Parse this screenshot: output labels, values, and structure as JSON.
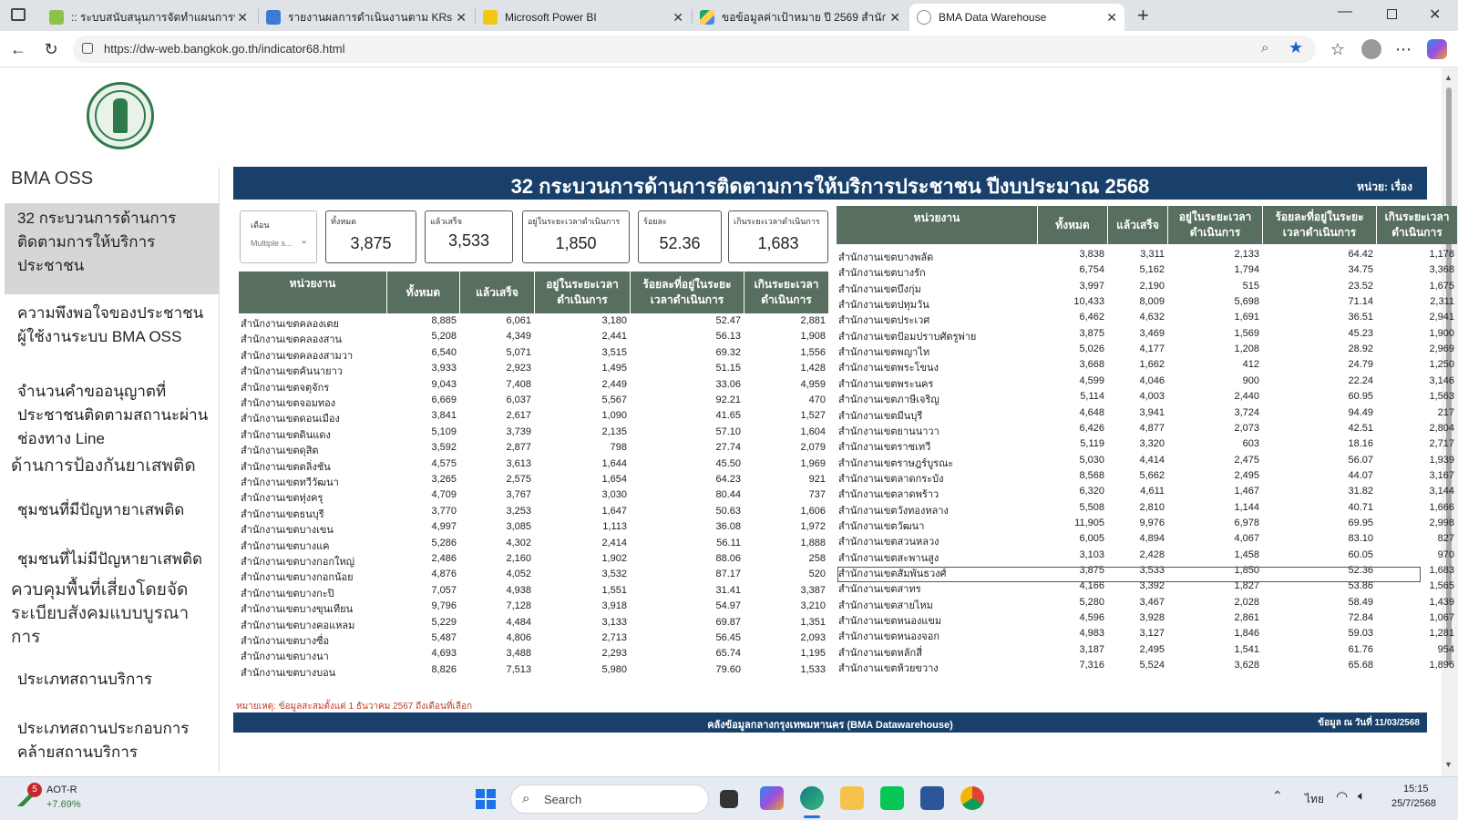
{
  "browser": {
    "tabs": [
      {
        "title": ":: ระบบสนับสนุนการจัดทำแผนการพัฒ",
        "icon": "sheet-icon"
      },
      {
        "title": "รายงานผลการดำเนินงานตาม KRs",
        "icon": "shield-icon"
      },
      {
        "title": "Microsoft Power BI",
        "icon": "powerbi-icon"
      },
      {
        "title": "ขอข้อมูลค่าเป้าหมาย ปี 2569 สำนักงา",
        "icon": "drive-icon"
      },
      {
        "title": "BMA Data Warehouse",
        "icon": "globe-icon"
      }
    ],
    "url": "https://dw-web.bangkok.go.th/indicator68.html"
  },
  "sidebar": {
    "header": "BMA OSS",
    "items": [
      {
        "label": "32 กระบวนการด้านการติดตามการให้บริการประชาชน",
        "lines": [
          "32 กระบวนการด้านการ",
          "ติดตามการให้บริการ",
          "ประชาชน"
        ]
      },
      {
        "label": "ความพึงพอใจของประชาชนผู้ใช้งานระบบ BMA OSS",
        "lines": [
          "ความพึงพอใจของประชาชน",
          "ผู้ใช้งานระบบ BMA OSS"
        ]
      },
      {
        "label": "จำนวนคำขออนุญาตที่ประชาชนติดตามสถานะผ่านช่องทาง Line",
        "lines": [
          "จำนวนคำขออนุญาตที่",
          "ประชาชนติดตามสถานะผ่าน",
          "ช่องทาง Line"
        ]
      },
      {
        "label": "ด้านการป้องกันยาเสพติด",
        "lines": [
          "ด้านการป้องกันยาเสพติด"
        ]
      },
      {
        "label": "ชุมชนที่มีปัญหายาเสพติด",
        "lines": [
          "ชุมชนที่มีปัญหายาเสพติด"
        ]
      },
      {
        "label": "ชุมชนที่ไม่มีปัญหายาเสพติด",
        "lines": [
          "ชุมชนที่ไม่มีปัญหายาเสพติด"
        ]
      },
      {
        "label": "ควบคุมพื้นที่เสี่ยงโดยจัดระเบียบสังคมแบบบูรณาการ",
        "lines": [
          "ควบคุมพื้นที่เสี่ยงโดยจัด",
          "ระเบียบสังคมแบบบูรณา",
          "การ"
        ]
      },
      {
        "label": "ประเภทสถานบริการ",
        "lines": [
          "ประเภทสถานบริการ"
        ]
      },
      {
        "label": "ประเภทสถานประกอบการคล้ายสถานบริการ",
        "lines": [
          "ประเภทสถานประกอบการ",
          "คล้ายสถานบริการ"
        ]
      }
    ]
  },
  "report": {
    "title": "32 กระบวนการด้านการติดตามการให้บริการประชาชน ปีงบประมาณ 2568",
    "unit": "หน่วย: เรื่อง",
    "slicer": {
      "label": "เดือน",
      "value": "Multiple s..."
    },
    "cards": [
      {
        "label": "ทั้งหมด",
        "value": "3,875"
      },
      {
        "label": "แล้วเสร็จ",
        "value": "3,533"
      },
      {
        "label": "อยู่ในระยะเวลาดำเนินการ",
        "value": "1,850"
      },
      {
        "label": "ร้อยละ",
        "value": "52.36"
      },
      {
        "label": "เกินระยะเวลาดำเนินการ",
        "value": "1,683"
      }
    ],
    "columns": [
      "หน่วยงาน",
      "ทั้งหมด",
      "แล้วเสร็จ",
      "อยู่ในระยะเวลา ดำเนินการ",
      "ร้อยละที่อยู่ในระยะ เวลาดำเนินการ",
      "เกินระยะเวลา ดำเนินการ"
    ],
    "left_rows": [
      [
        "สำนักงานเขตคลองเตย",
        "8,885",
        "6,061",
        "3,180",
        "52.47",
        "2,881"
      ],
      [
        "สำนักงานเขตคลองสาน",
        "5,208",
        "4,349",
        "2,441",
        "56.13",
        "1,908"
      ],
      [
        "สำนักงานเขตคลองสามวา",
        "6,540",
        "5,071",
        "3,515",
        "69.32",
        "1,556"
      ],
      [
        "สำนักงานเขตคันนายาว",
        "3,933",
        "2,923",
        "1,495",
        "51.15",
        "1,428"
      ],
      [
        "สำนักงานเขตจตุจักร",
        "9,043",
        "7,408",
        "2,449",
        "33.06",
        "4,959"
      ],
      [
        "สำนักงานเขตจอมทอง",
        "6,669",
        "6,037",
        "5,567",
        "92.21",
        "470"
      ],
      [
        "สำนักงานเขตดอนเมือง",
        "3,841",
        "2,617",
        "1,090",
        "41.65",
        "1,527"
      ],
      [
        "สำนักงานเขตดินแดง",
        "5,109",
        "3,739",
        "2,135",
        "57.10",
        "1,604"
      ],
      [
        "สำนักงานเขตดุสิต",
        "3,592",
        "2,877",
        "798",
        "27.74",
        "2,079"
      ],
      [
        "สำนักงานเขตตลิ่งชัน",
        "4,575",
        "3,613",
        "1,644",
        "45.50",
        "1,969"
      ],
      [
        "สำนักงานเขตทวีวัฒนา",
        "3,265",
        "2,575",
        "1,654",
        "64.23",
        "921"
      ],
      [
        "สำนักงานเขตทุ่งครุ",
        "4,709",
        "3,767",
        "3,030",
        "80.44",
        "737"
      ],
      [
        "สำนักงานเขตธนบุรี",
        "3,770",
        "3,253",
        "1,647",
        "50.63",
        "1,606"
      ],
      [
        "สำนักงานเขตบางเขน",
        "4,997",
        "3,085",
        "1,113",
        "36.08",
        "1,972"
      ],
      [
        "สำนักงานเขตบางแค",
        "5,286",
        "4,302",
        "2,414",
        "56.11",
        "1,888"
      ],
      [
        "สำนักงานเขตบางกอกใหญ่",
        "2,486",
        "2,160",
        "1,902",
        "88.06",
        "258"
      ],
      [
        "สำนักงานเขตบางกอกน้อย",
        "4,876",
        "4,052",
        "3,532",
        "87.17",
        "520"
      ],
      [
        "สำนักงานเขตบางกะปิ",
        "7,057",
        "4,938",
        "1,551",
        "31.41",
        "3,387"
      ],
      [
        "สำนักงานเขตบางขุนเทียน",
        "9,796",
        "7,128",
        "3,918",
        "54.97",
        "3,210"
      ],
      [
        "สำนักงานเขตบางคอแหลม",
        "5,229",
        "4,484",
        "3,133",
        "69.87",
        "1,351"
      ],
      [
        "สำนักงานเขตบางซื่อ",
        "5,487",
        "4,806",
        "2,713",
        "56.45",
        "2,093"
      ],
      [
        "สำนักงานเขตบางนา",
        "4,693",
        "3,488",
        "2,293",
        "65.74",
        "1,195"
      ],
      [
        "สำนักงานเขตบางบอน",
        "8,826",
        "7,513",
        "5,980",
        "79.60",
        "1,533"
      ]
    ],
    "right_rows": [
      [
        "สำนักงานเขตบางพลัด",
        "3,838",
        "3,311",
        "2,133",
        "64.42",
        "1,178"
      ],
      [
        "สำนักงานเขตบางรัก",
        "6,754",
        "5,162",
        "1,794",
        "34.75",
        "3,368"
      ],
      [
        "สำนักงานเขตบึงกุ่ม",
        "3,997",
        "2,190",
        "515",
        "23.52",
        "1,675"
      ],
      [
        "สำนักงานเขตปทุมวัน",
        "10,433",
        "8,009",
        "5,698",
        "71.14",
        "2,311"
      ],
      [
        "สำนักงานเขตประเวศ",
        "6,462",
        "4,632",
        "1,691",
        "36.51",
        "2,941"
      ],
      [
        "สำนักงานเขตป้อมปราบศัตรูพ่าย",
        "3,875",
        "3,469",
        "1,569",
        "45.23",
        "1,900"
      ],
      [
        "สำนักงานเขตพญาไท",
        "5,026",
        "4,177",
        "1,208",
        "28.92",
        "2,969"
      ],
      [
        "สำนักงานเขตพระโขนง",
        "3,668",
        "1,662",
        "412",
        "24.79",
        "1,250"
      ],
      [
        "สำนักงานเขตพระนคร",
        "4,599",
        "4,046",
        "900",
        "22.24",
        "3,146"
      ],
      [
        "สำนักงานเขตภาษีเจริญ",
        "5,114",
        "4,003",
        "2,440",
        "60.95",
        "1,563"
      ],
      [
        "สำนักงานเขตมีนบุรี",
        "4,648",
        "3,941",
        "3,724",
        "94.49",
        "217"
      ],
      [
        "สำนักงานเขตยานนาวา",
        "6,426",
        "4,877",
        "2,073",
        "42.51",
        "2,804"
      ],
      [
        "สำนักงานเขตราชเทวี",
        "5,119",
        "3,320",
        "603",
        "18.16",
        "2,717"
      ],
      [
        "สำนักงานเขตราษฎร์บูรณะ",
        "5,030",
        "4,414",
        "2,475",
        "56.07",
        "1,939"
      ],
      [
        "สำนักงานเขตลาดกระบัง",
        "8,568",
        "5,662",
        "2,495",
        "44.07",
        "3,167"
      ],
      [
        "สำนักงานเขตลาดพร้าว",
        "6,320",
        "4,611",
        "1,467",
        "31.82",
        "3,144"
      ],
      [
        "สำนักงานเขตวังทองหลาง",
        "5,508",
        "2,810",
        "1,144",
        "40.71",
        "1,666"
      ],
      [
        "สำนักงานเขตวัฒนา",
        "11,905",
        "9,976",
        "6,978",
        "69.95",
        "2,998"
      ],
      [
        "สำนักงานเขตสวนหลวง",
        "6,005",
        "4,894",
        "4,067",
        "83.10",
        "827"
      ],
      [
        "สำนักงานเขตสะพานสูง",
        "3,103",
        "2,428",
        "1,458",
        "60.05",
        "970"
      ],
      [
        "สำนักงานเขตสัมพันธวงศ์",
        "3,875",
        "3,533",
        "1,850",
        "52.36",
        "1,683"
      ],
      [
        "สำนักงานเขตสาทร",
        "4,166",
        "3,392",
        "1,827",
        "53.86",
        "1,565"
      ],
      [
        "สำนักงานเขตสายไหม",
        "5,280",
        "3,467",
        "2,028",
        "58.49",
        "1,439"
      ],
      [
        "สำนักงานเขตหนองแขม",
        "4,596",
        "3,928",
        "2,861",
        "72.84",
        "1,067"
      ],
      [
        "สำนักงานเขตหนองจอก",
        "4,983",
        "3,127",
        "1,846",
        "59.03",
        "1,281"
      ],
      [
        "สำนักงานเขตหลักสี่",
        "3,187",
        "2,495",
        "1,541",
        "61.76",
        "954"
      ],
      [
        "สำนักงานเขตห้วยขวาง",
        "7,316",
        "5,524",
        "3,628",
        "65.68",
        "1,896"
      ]
    ],
    "note": "หมายเหตุ: ข้อมูลสะสมตั้งแต่ 1 ธันวาคม 2567 ถึงเดือนที่เลือก",
    "footer": "คลังข้อมูลกลางกรุงเทพมหานคร (BMA Datawarehouse)",
    "data_date": "ข้อมูล ณ วันที่ 11/03/2568"
  },
  "taskbar": {
    "stock_name": "AOT-R",
    "stock_change": "+7.69%",
    "stock_badge": "5",
    "search_placeholder": "Search",
    "language": "ไทย",
    "time": "15:15",
    "date": "25/7/2568"
  }
}
